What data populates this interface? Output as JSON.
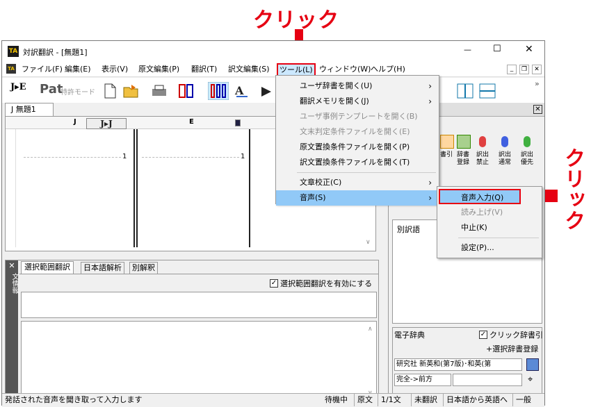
{
  "callouts": {
    "top": "クリック",
    "right": "クリック"
  },
  "window": {
    "title": "対訳翻訳 - [無題1]",
    "controls": {
      "minimize": "—",
      "maximize": "☐",
      "close": "✕"
    },
    "mdi_controls": {
      "minimize": "_",
      "restore": "❐",
      "close": "✕"
    }
  },
  "menu": {
    "items": [
      "ファイル(F)",
      "編集(E)",
      "表示(V)",
      "原文編集(P)",
      "翻訳(T)",
      "訳文編集(S)",
      "ツール(L)",
      "ウィンドウ(W)",
      "ヘルプ(H)"
    ]
  },
  "toolbar": {
    "je_label": "J▸E",
    "pat_label": "Pat",
    "patent_mode": "特許モード",
    "more": "»"
  },
  "document": {
    "tab": "J  無題1",
    "col_j": "J",
    "col_jj": "J▸J",
    "col_e": "E",
    "line_num_1": "1",
    "line_num_2": "1"
  },
  "tools_menu": {
    "items": [
      {
        "label": "ユーザ辞書を開く(U)",
        "arrow": "›",
        "disabled": false
      },
      {
        "label": "翻訳メモリを開く(J)",
        "arrow": "›",
        "disabled": false
      },
      {
        "label": "ユーザ事例テンプレートを開く(B)",
        "arrow": "",
        "disabled": true
      },
      {
        "label": "文末判定条件ファイルを開く(E)",
        "arrow": "",
        "disabled": true
      },
      {
        "label": "原文置換条件ファイルを開く(P)",
        "arrow": "",
        "disabled": false
      },
      {
        "label": "訳文置換条件ファイルを開く(T)",
        "arrow": "",
        "disabled": false
      },
      {
        "label": "文章校正(C)",
        "arrow": "›",
        "disabled": false
      },
      {
        "label": "音声(S)",
        "arrow": "›",
        "disabled": false
      }
    ]
  },
  "voice_submenu": {
    "items": [
      {
        "label": "音声入力(Q)",
        "disabled": false
      },
      {
        "label": "読み上げ(V)",
        "disabled": true
      },
      {
        "label": "中止(K)",
        "disabled": false
      },
      {
        "label": "設定(P)...",
        "disabled": false
      }
    ]
  },
  "right_panel": {
    "buttons": [
      "書引",
      "辞書\n登録",
      "訳出\n禁止",
      "訳出\n通常",
      "訳出\n優先"
    ],
    "alt_word_header": "別訳語",
    "edict_title": "電子辞典",
    "click_lookup": "クリック辞書引",
    "add_dict": "+選択辞書登録",
    "dict_select": "研究社 新英和(第7版)･和英(第",
    "match_select": "完全->前方"
  },
  "bottom_panel": {
    "side_label": "文情報",
    "tabs": [
      "選択範囲翻訳",
      "日本語解析",
      "別解釈"
    ],
    "enable_checkbox": "選択範囲翻訳を有効にする"
  },
  "status": {
    "message": "発話された音声を聞き取って入力します",
    "state": "待機中",
    "source": "原文",
    "count": "1/1文",
    "untrans": "未翻訳",
    "direction": "日本語から英語へ",
    "mode": "一般"
  }
}
